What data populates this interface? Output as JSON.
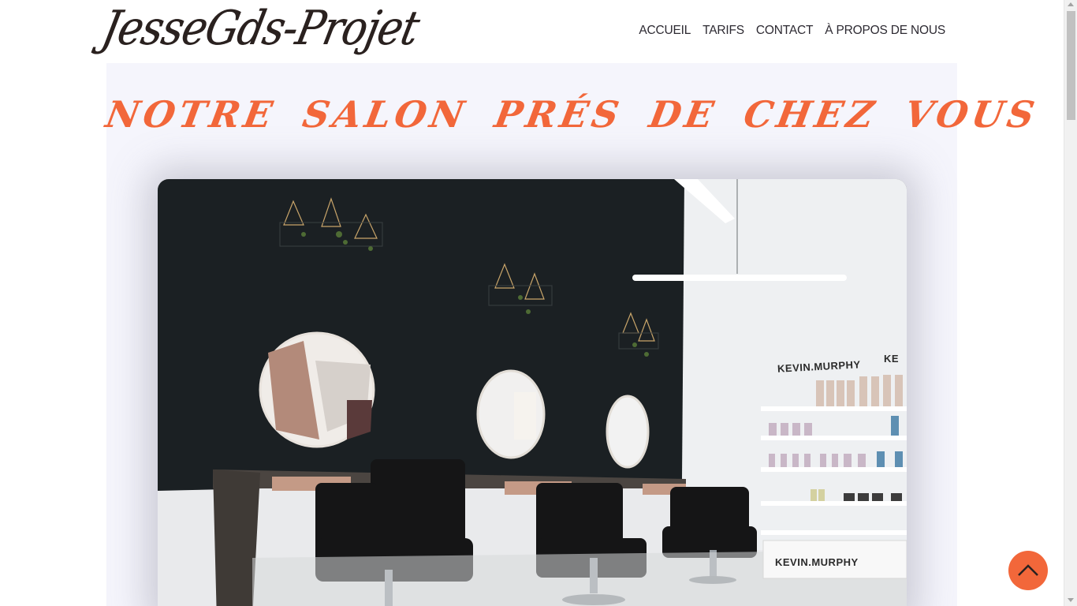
{
  "header": {
    "logo_text": "JesseGds-Projet",
    "nav": [
      {
        "label": "ACCUEIL"
      },
      {
        "label": "TARIFS"
      },
      {
        "label": "CONTACT"
      },
      {
        "label": "À PROPOS DE NOUS"
      }
    ]
  },
  "hero": {
    "title": "NOTRE SALON PRÉS DE CHEZ VOUS",
    "image": {
      "brand_sign_1": "KEVIN.MURPHY",
      "brand_sign_2": "KEVIN.MURPHY",
      "brand_sign_partial": "KE"
    }
  },
  "scroll_to_top": {
    "icon": "chevron-up-icon"
  },
  "colors": {
    "accent": "#f2673a",
    "nav_text": "#2d2a32",
    "logo": "#2a211f",
    "panel_bg": "#f5f5fc"
  }
}
